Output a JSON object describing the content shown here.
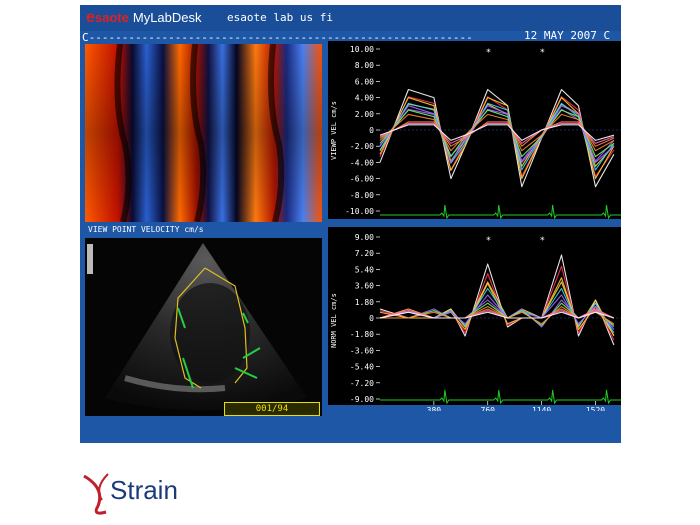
{
  "header": {
    "brand_e": "e",
    "brand_name": "saote",
    "brand_product": "MyLabDesk",
    "title": "esaote lab us fi",
    "date": "12 MAY 2007",
    "date_suffix": "C"
  },
  "dash_line": "C----------------------------------------------------------",
  "left_panel": {
    "velocity_label": "VIEW POINT VELOCITY cm/s",
    "frame_counter": "001/94"
  },
  "upper_plot": {
    "ylabel": "VIEWP VEL cm/s",
    "top_label": "10.00",
    "ticks": [
      "8.00",
      "6.00",
      "4.00",
      "2.00",
      "0",
      "-2.00",
      "-4.00",
      "-6.00",
      "-8.00"
    ],
    "bottom_label": "-10.00",
    "marker": "*"
  },
  "lower_plot": {
    "ylabel": "NORM VEL cm/s",
    "top_label": "9.00",
    "ticks": [
      "7.20",
      "5.40",
      "3.60",
      "1.80",
      "0",
      "-1.80",
      "-3.60",
      "-5.40",
      "-7.20"
    ],
    "bottom_label": "-9.00"
  },
  "x_axis": {
    "ticks": [
      "380",
      "760",
      "1140",
      "1520"
    ]
  },
  "footer_logo": "Strain",
  "colors": {
    "screen_bg": "#1d57a6",
    "plot_bg": "#000000",
    "ecg": "#22cc22",
    "logo_red": "#c0202a",
    "logo_blue": "#1a3a7a"
  },
  "chart_data": [
    {
      "type": "line",
      "title": "",
      "ylabel": "VIEWP VEL cm/s",
      "ylim": [
        -10,
        10
      ],
      "x": [
        0,
        200,
        380,
        500,
        600,
        760,
        900,
        1000,
        1140,
        1280,
        1400,
        1520,
        1650
      ],
      "series": [
        {
          "values": [
            -4,
            5,
            4,
            -6,
            -2,
            5,
            3,
            -7,
            -1,
            5,
            3,
            -7,
            -3
          ]
        },
        {
          "values": [
            -3,
            4,
            3,
            -5,
            -2,
            4,
            3,
            -6,
            -1,
            4,
            2,
            -6,
            -2
          ]
        },
        {
          "values": [
            -2,
            3,
            2,
            -4,
            -1,
            3,
            2,
            -4,
            -1,
            3,
            2,
            -4,
            -2
          ]
        },
        {
          "values": [
            -1,
            1,
            1,
            -2,
            -1,
            1,
            1,
            -2,
            0,
            1,
            1,
            -2,
            -1
          ]
        }
      ]
    },
    {
      "type": "line",
      "title": "",
      "ylabel": "NORM VEL cm/s",
      "ylim": [
        -9,
        9
      ],
      "x": [
        0,
        200,
        380,
        500,
        600,
        760,
        900,
        1000,
        1140,
        1280,
        1400,
        1520,
        1650
      ],
      "series": [
        {
          "values": [
            1,
            0,
            0,
            1,
            -2,
            6,
            -1,
            0,
            0,
            7,
            -2,
            2,
            -3
          ]
        },
        {
          "values": [
            0,
            1,
            0,
            1,
            -1,
            4,
            0,
            1,
            0,
            4,
            -1,
            2,
            -2
          ]
        },
        {
          "values": [
            0,
            0,
            1,
            0,
            0,
            2,
            0,
            1,
            -1,
            2,
            0,
            1,
            -1
          ]
        },
        {
          "values": [
            0,
            1,
            0,
            0,
            0,
            1,
            0,
            0,
            0,
            1,
            0,
            1,
            0
          ]
        }
      ]
    }
  ]
}
